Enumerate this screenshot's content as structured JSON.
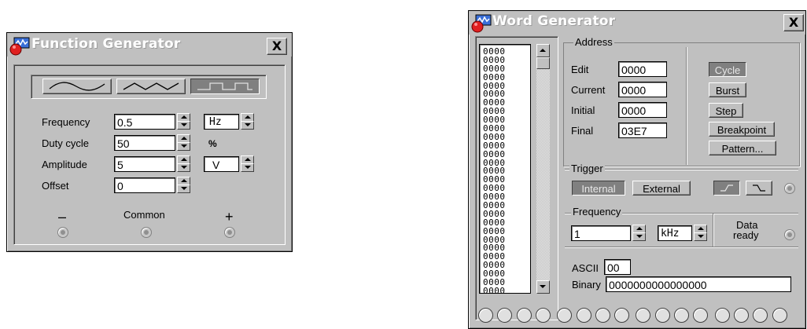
{
  "function_generator": {
    "title": "Function Generator",
    "close_label": "X",
    "waveforms": [
      "sine-wave-icon",
      "triangle-wave-icon",
      "square-wave-icon"
    ],
    "selected_waveform": "square",
    "frequency": {
      "label": "Frequency",
      "value": "0.5",
      "unit": "Hz"
    },
    "duty_cycle": {
      "label": "Duty cycle",
      "value": "50",
      "unit": "%"
    },
    "amplitude": {
      "label": "Amplitude",
      "value": "5",
      "unit": "V"
    },
    "offset": {
      "label": "Offset",
      "value": "0"
    },
    "terminals": {
      "minus": "–",
      "common": "Common",
      "plus": "+"
    }
  },
  "word_generator": {
    "title": "Word Generator",
    "close_label": "X",
    "memory_row_value": "0000",
    "memory_visible_rows": 33,
    "address": {
      "caption": "Address",
      "edit": {
        "label": "Edit",
        "value": "0000"
      },
      "current": {
        "label": "Current",
        "value": "0000"
      },
      "initial": {
        "label": "Initial",
        "value": "0000"
      },
      "final": {
        "label": "Final",
        "value": "03E7"
      }
    },
    "mode_buttons": {
      "cycle": "Cycle",
      "burst": "Burst",
      "step": "Step",
      "breakpoint": "Breakpoint",
      "pattern": "Pattern..."
    },
    "trigger": {
      "caption": "Trigger",
      "internal": "Internal",
      "external": "External"
    },
    "frequency": {
      "caption": "Frequency",
      "value": "1",
      "unit": "kHz"
    },
    "data_ready": {
      "line1": "Data",
      "line2": "ready"
    },
    "ascii": {
      "label": "ASCII",
      "value": "00"
    },
    "binary": {
      "label": "Binary",
      "value": "0000000000000000"
    },
    "output_bits": 16
  },
  "colors": {
    "face": "#c0c0c0",
    "shadow": "#808080",
    "highlight": "#ffffff",
    "title_text": "#ffffff"
  }
}
